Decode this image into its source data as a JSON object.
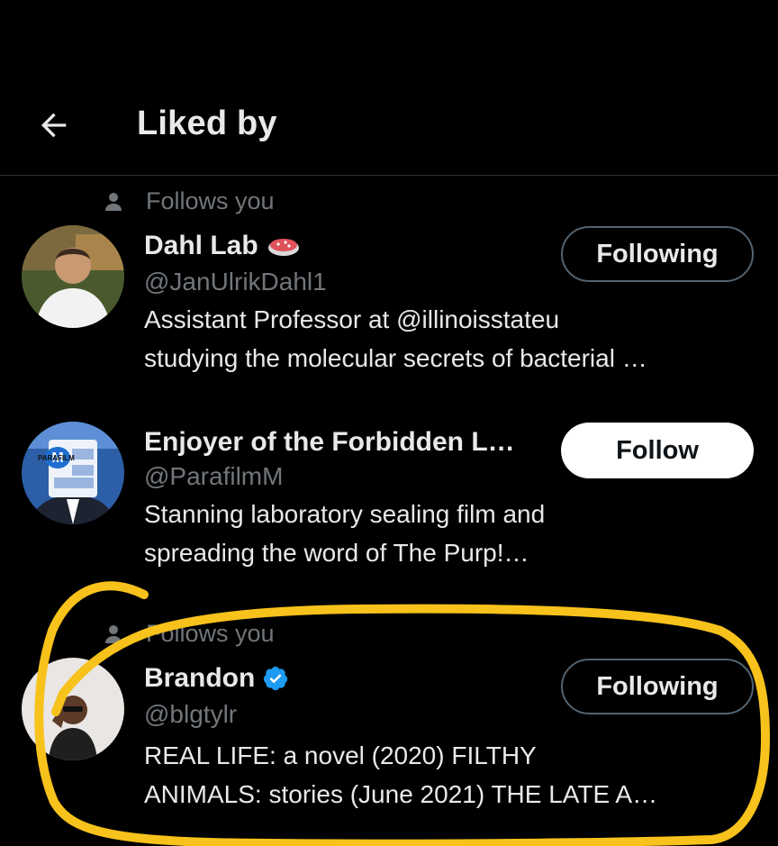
{
  "header": {
    "title": "Liked by",
    "back_icon": "arrow-left-icon"
  },
  "users": [
    {
      "follows_you": true,
      "follows_label": "Follows you",
      "name": "Dahl Lab",
      "name_emoji": "petri-dish-icon",
      "handle": "@JanUlrikDahl1",
      "bio_lines": [
        "Assistant Professor at @illinoisstateu",
        "studying the molecular secrets of bacterial …"
      ],
      "button": "Following"
    },
    {
      "follows_you": false,
      "name": "Enjoyer of the Forbidden L…",
      "handle": "@ParafilmM",
      "bio_lines": [
        "Stanning laboratory sealing film and",
        "spreading the word of The Purp!…"
      ],
      "button": "Follow",
      "avatar_text": "PARAFILM"
    },
    {
      "follows_you": true,
      "follows_label": "Follows you",
      "name": "Brandon",
      "verified": true,
      "handle": "@blgtylr",
      "bio_lines": [
        "REAL LIFE: a novel (2020)  FILTHY",
        "ANIMALS: stories (June 2021) THE LATE A…"
      ],
      "button": "Following"
    }
  ],
  "colors": {
    "background": "#000000",
    "muted": "#71767b",
    "verified": "#1d9bf0",
    "highlight": "#f7c21b"
  }
}
